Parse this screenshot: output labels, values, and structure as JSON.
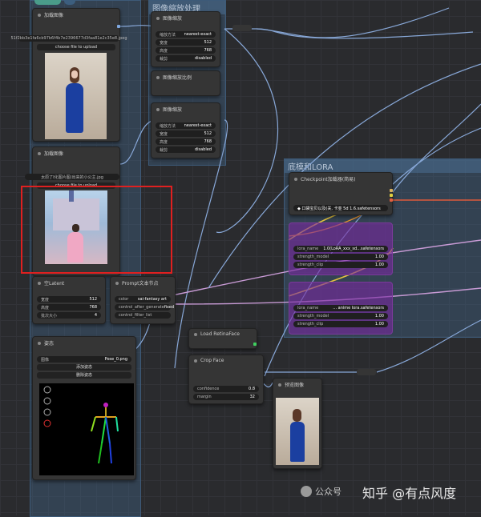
{
  "groups": {
    "image_scale": "图像缩放处理",
    "model_lora": "底模和LORA"
  },
  "nodes": {
    "load_image_1": {
      "title": "加载图像",
      "filename": "51f2bb3e1fa6cb97b6f4b7e2396677d3faa81e2c35e8.jpeg",
      "upload": "choose file to upload"
    },
    "load_image_2": {
      "title": "加载图像",
      "filename": "太原了Ⅰ化图片图(出来的小公主.jpg",
      "upload": "choose file to upload"
    },
    "scale_1": {
      "title": "图像缩放",
      "rows": [
        [
          "缩放方法",
          "nearest-exact"
        ],
        [
          "宽度",
          "512"
        ],
        [
          "高度",
          "768"
        ],
        [
          "裁剪",
          "disabled"
        ]
      ]
    },
    "scale_2": {
      "title": "图像缩放比例"
    },
    "scale_3": {
      "title": "图像缩放",
      "rows": [
        [
          "缩放方法",
          "nearest-exact"
        ],
        [
          "宽度",
          "512"
        ],
        [
          "高度",
          "768"
        ],
        [
          "裁剪",
          "disabled"
        ]
      ]
    },
    "empty_latent": {
      "title": "空Latent",
      "rows": [
        [
          "宽度",
          "512"
        ],
        [
          "高度",
          "768"
        ],
        [
          "批次大小",
          "4"
        ]
      ]
    },
    "prompt_style": {
      "title": "Prompt文本节点",
      "rows": [
        [
          "color",
          "sai-fantasy art"
        ],
        [
          "control_after_generate",
          "fixed"
        ],
        [
          "control_filter_list",
          ""
        ]
      ]
    },
    "pose": {
      "title": "姿态",
      "file": "Pose_0.png",
      "buttons": [
        "添加姿态",
        "删除姿态"
      ]
    },
    "checkpoint": {
      "title": "Checkpoint加载器(简易)",
      "model": "◆ 口袋宝贝以及(关, 卡亚 5d 1.6.safetensors"
    },
    "lora_1": {
      "rows": [
        [
          "lora_name",
          "1.0(LoRA_xxx_sd...safetensors"
        ],
        [
          "strength_model",
          "1.00"
        ],
        [
          "strength_clip",
          "1.00"
        ]
      ]
    },
    "lora_2": {
      "rows": [
        [
          "lora_name",
          "... anime lora.safetensors"
        ],
        [
          "strength_model",
          "1.00"
        ],
        [
          "strength_clip",
          "1.00"
        ]
      ]
    },
    "retina": {
      "title": "Load RetinaFace"
    },
    "crop_face": {
      "title": "Crop Face",
      "rows": [
        [
          "confidence",
          "0.8"
        ],
        [
          "margin",
          "32"
        ]
      ]
    },
    "preview": {
      "title": "预览图像"
    }
  },
  "watermark": {
    "text": "公众号"
  },
  "zhihu": "知乎 @有点风度"
}
